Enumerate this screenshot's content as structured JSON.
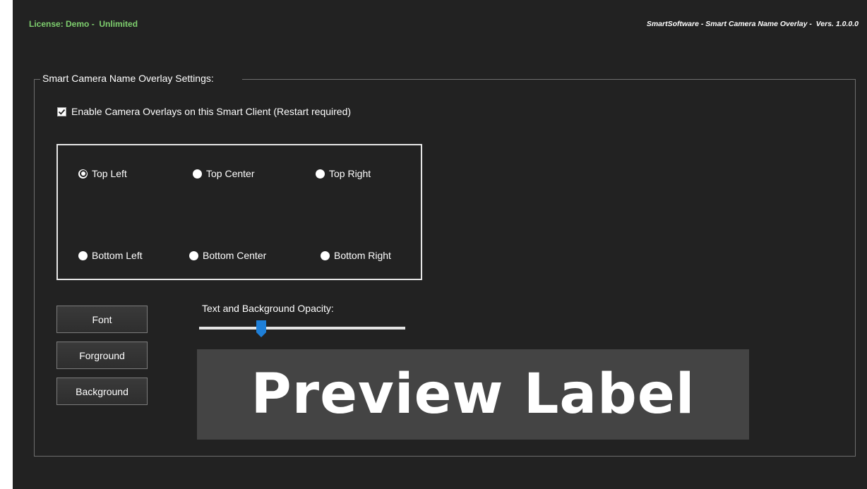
{
  "header": {
    "license": "License: Demo -  Unlimited",
    "app_title": "SmartSoftware - Smart Camera Name Overlay -  Vers. 1.0.0.0"
  },
  "settings": {
    "group_title": "Smart Camera Name Overlay Settings:",
    "enable_overlays": {
      "label": "Enable Camera Overlays on this Smart Client  (Restart required)",
      "checked": true
    },
    "positions": [
      {
        "label": "Top Left",
        "selected": true
      },
      {
        "label": "Top Center",
        "selected": false
      },
      {
        "label": "Top Right",
        "selected": false
      },
      {
        "label": "Bottom Left",
        "selected": false
      },
      {
        "label": "Bottom Center",
        "selected": false
      },
      {
        "label": "Bottom Right",
        "selected": false
      }
    ],
    "buttons": {
      "font": "Font",
      "foreground": "Forground",
      "background": "Background"
    },
    "opacity": {
      "label": "Text and Background Opacity:",
      "value_fraction": 0.3
    },
    "preview_label": "Preview Label"
  },
  "colors": {
    "window_bg": "#222222",
    "license_text": "#7ecf6e",
    "slider_thumb": "#1e7fd8",
    "preview_bg": "#444444"
  }
}
